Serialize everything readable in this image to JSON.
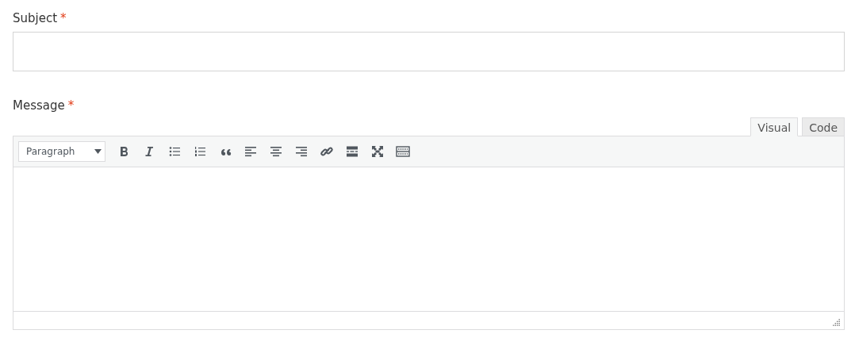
{
  "fields": [
    {
      "label": "Subject",
      "required_mark": "*"
    }
  ],
  "message": {
    "label": "Message",
    "required_mark": "*",
    "tabs": [
      {
        "label": "Visual",
        "selected": true
      },
      {
        "label": "Code",
        "selected": false
      }
    ],
    "format_select": {
      "value": "Paragraph"
    },
    "tools": [
      {
        "kind": "bold"
      },
      {
        "kind": "italic"
      },
      {
        "kind": "bullets"
      },
      {
        "kind": "numbers"
      },
      {
        "kind": "quote"
      },
      {
        "kind": "align-left"
      },
      {
        "kind": "align-center"
      },
      {
        "kind": "align-right"
      },
      {
        "kind": "link"
      },
      {
        "kind": "more"
      },
      {
        "kind": "fullscreen"
      },
      {
        "kind": "toolbar-toggle"
      }
    ]
  }
}
